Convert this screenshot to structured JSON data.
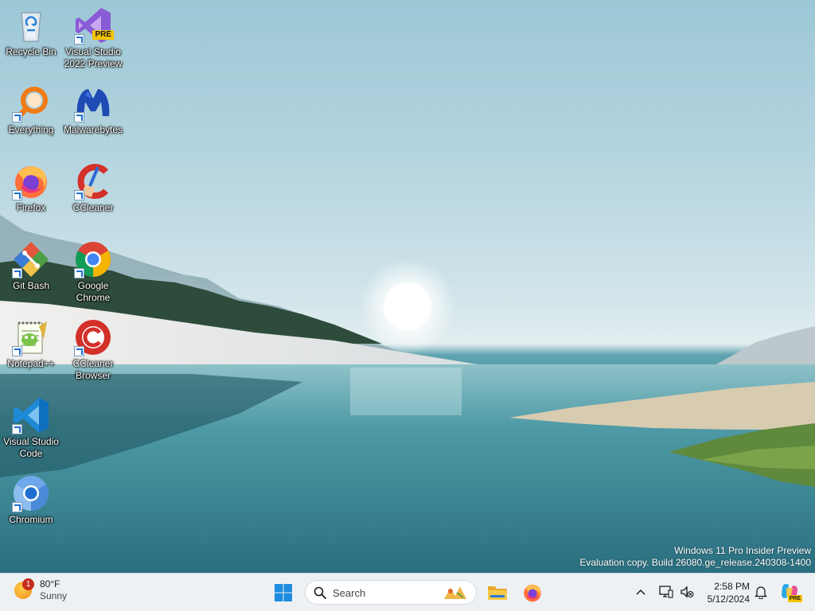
{
  "desktop": {
    "icons": [
      {
        "name": "recycle-bin-icon",
        "label": "Recycle Bin"
      },
      {
        "name": "visual-studio-2022-preview-icon",
        "label": "Visual Studio 2022 Preview"
      },
      {
        "name": "everything-icon",
        "label": "Everything"
      },
      {
        "name": "malwarebytes-icon",
        "label": "Malwarebytes"
      },
      {
        "name": "firefox-icon",
        "label": "Firefox"
      },
      {
        "name": "ccleaner-icon",
        "label": "CCleaner"
      },
      {
        "name": "git-bash-icon",
        "label": "Git Bash"
      },
      {
        "name": "google-chrome-icon",
        "label": "Google Chrome"
      },
      {
        "name": "notepad-plus-plus-icon",
        "label": "Notepad++"
      },
      {
        "name": "ccleaner-browser-icon",
        "label": "CCleaner Browser"
      },
      {
        "name": "visual-studio-code-icon",
        "label": "Visual Studio Code"
      },
      {
        "name": "chromium-icon",
        "label": "Chromium"
      }
    ],
    "vs_badge": "PRE"
  },
  "watermark": {
    "line1": "Windows 11 Pro Insider Preview",
    "line2": "Evaluation copy. Build 26080.ge_release.240308-1400"
  },
  "taskbar": {
    "weather": {
      "temp": "80°F",
      "condition": "Sunny",
      "badge": "1"
    },
    "search_placeholder": "Search",
    "pinned": [
      "start-button",
      "file-explorer",
      "firefox"
    ],
    "tray": {
      "time": "2:58 PM",
      "date": "5/12/2024",
      "copilot_badge": "PRE"
    }
  },
  "colors": {
    "accent": "#0067c0",
    "taskbar_bg": "#eef1f4"
  }
}
